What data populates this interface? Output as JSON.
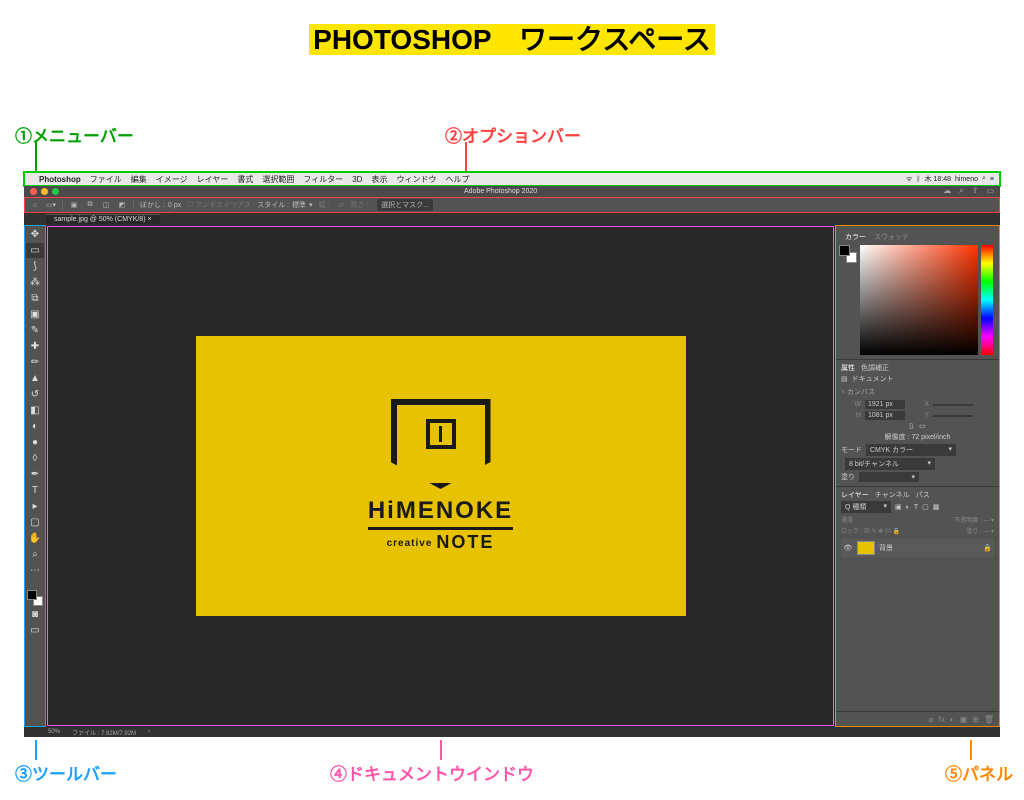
{
  "title": "PHOTOSHOP　ワークスペース",
  "annotations": {
    "a1": "①メニューバー",
    "a2": "②オプションバー",
    "a3": "③ツールバー",
    "a4": "④ドキュメントウインドウ",
    "a5": "⑤パネル"
  },
  "menubar": {
    "apple": "",
    "app": "Photoshop",
    "items": [
      "ファイル",
      "編集",
      "イメージ",
      "レイヤー",
      "書式",
      "選択範囲",
      "フィルター",
      "3D",
      "表示",
      "ウィンドウ",
      "ヘルプ"
    ],
    "right": {
      "clock": "木 18:48",
      "user": "himeno"
    }
  },
  "app_titlebar": "Adobe Photoshop 2020",
  "options_bar": {
    "feather_label": "ぼかし :",
    "feather_value": "0 px",
    "antialias": "アンチエイリアス",
    "style_label": "スタイル :",
    "style_value": "標準",
    "w_label": "幅 :",
    "h_label": "高さ :",
    "mask_button": "選択とマスク..."
  },
  "doc_tab": "sample.jpg @ 50% (CMYK/8)",
  "canvas_logo": {
    "line1": "HiMENOKE",
    "line2_small": "creative",
    "line2": "NOTE"
  },
  "panels": {
    "color": {
      "tab1": "カラー",
      "tab2": "スウォッチ"
    },
    "properties": {
      "tab1": "属性",
      "tab2": "色調補正",
      "doctype": "ドキュメント",
      "canvas_header": "カンバス",
      "w_label": "W",
      "w_value": "1921 px",
      "x_label": "X",
      "h_label": "H",
      "h_value": "1081 px",
      "y_label": "Y",
      "resolution": "解像度 : 72 pixel/inch",
      "mode_label": "モード",
      "mode_value": "CMYK カラー",
      "bit_value": "8 bit/チャンネル",
      "fill_label": "塗り"
    },
    "layers": {
      "tab1": "レイヤー",
      "tab2": "チャンネル",
      "tab3": "パス",
      "kind": "Q 種類",
      "opacity_label": "不透明度",
      "opacity_caret": "",
      "blend": "通常",
      "lock_label": "ロック :",
      "layer_name": "背景"
    }
  },
  "status": {
    "zoom": "50%",
    "filesize": "ファイル : 7.92M/7.92M"
  }
}
